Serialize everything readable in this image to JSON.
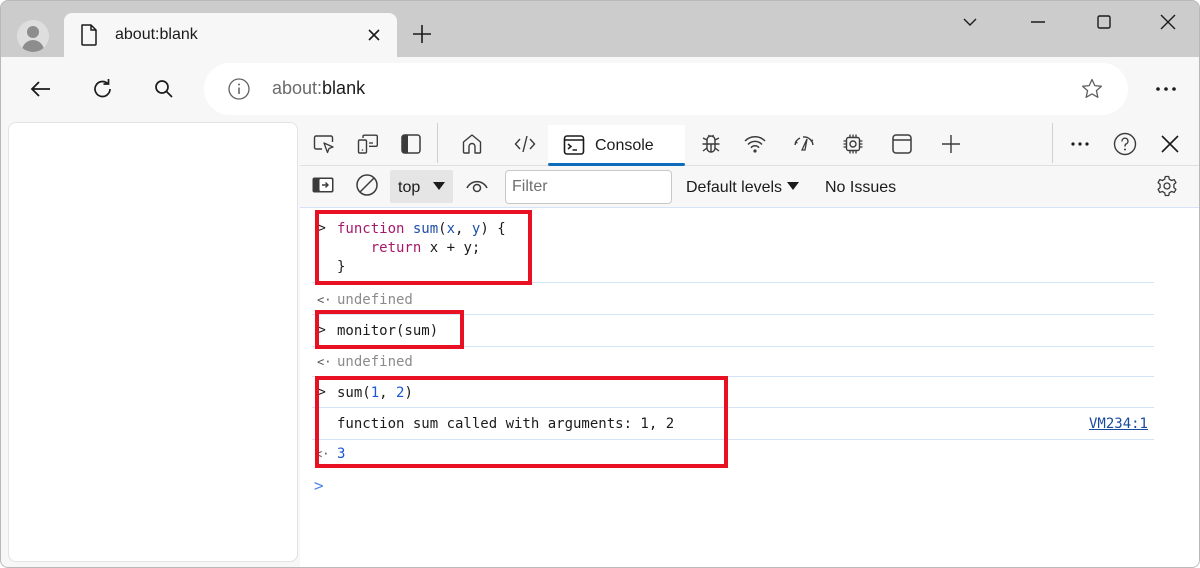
{
  "browser": {
    "tab": {
      "title": "about:blank",
      "icon": "page-icon",
      "close_icon": "close-icon"
    },
    "new_tab_icon": "plus-icon",
    "window_controls": [
      "tab-actions-chevron-icon",
      "minimize-icon",
      "maximize-icon",
      "close-icon"
    ],
    "nav": {
      "back_icon": "arrow-left-icon",
      "refresh_icon": "refresh-icon",
      "search_icon": "search-icon"
    },
    "address": {
      "scheme": "about:",
      "rest": "blank",
      "info_icon": "info-icon",
      "favorite_icon": "star-icon"
    },
    "menu_icon": "more-horizontal-icon"
  },
  "devtools": {
    "tabs_left_icons": [
      "inspect-element-icon",
      "device-emulation-icon",
      "dock-side-icon"
    ],
    "tabs": [
      {
        "name": "welcome",
        "icon": "home-icon"
      },
      {
        "name": "elements",
        "icon": "code-icon"
      },
      {
        "name": "console",
        "icon": "console-icon",
        "label": "Console",
        "active": true
      },
      {
        "name": "sources",
        "icon": "bug-icon"
      },
      {
        "name": "network",
        "icon": "wifi-icon"
      },
      {
        "name": "performance",
        "icon": "gauge-icon"
      },
      {
        "name": "memory",
        "icon": "chip-icon"
      },
      {
        "name": "application",
        "icon": "window-icon"
      },
      {
        "name": "more-tools",
        "icon": "plus-icon"
      }
    ],
    "right_icons": [
      "more-horizontal-icon",
      "help-icon",
      "close-icon"
    ],
    "accent": "#0f6cbd",
    "filterbar": {
      "sidebar_icon": "show-sidebar-icon",
      "clear_icon": "clear-console-icon",
      "context": "top",
      "live_expression_icon": "eye-icon",
      "filter_placeholder": "Filter",
      "filter_value": "",
      "levels": "Default levels",
      "issues": "No Issues",
      "settings_icon": "gear-icon"
    },
    "console": {
      "entries": [
        {
          "type": "input",
          "lines": [
            "function sum(x, y) {",
            "    return x + y;",
            "}"
          ]
        },
        {
          "type": "result",
          "text": "undefined"
        },
        {
          "type": "input",
          "text": "monitor(sum)"
        },
        {
          "type": "result",
          "text": "undefined"
        },
        {
          "type": "input",
          "text": "sum(1, 2)",
          "fn": "sum(",
          "a": "1",
          "sep": ", ",
          "b": "2",
          "close": ")"
        },
        {
          "type": "log",
          "text": "function sum called with arguments: 1, 2",
          "source": "VM234:1"
        },
        {
          "type": "result",
          "text": "3"
        }
      ],
      "prompt_symbol": ">",
      "highlight_color": "#e81123"
    }
  }
}
